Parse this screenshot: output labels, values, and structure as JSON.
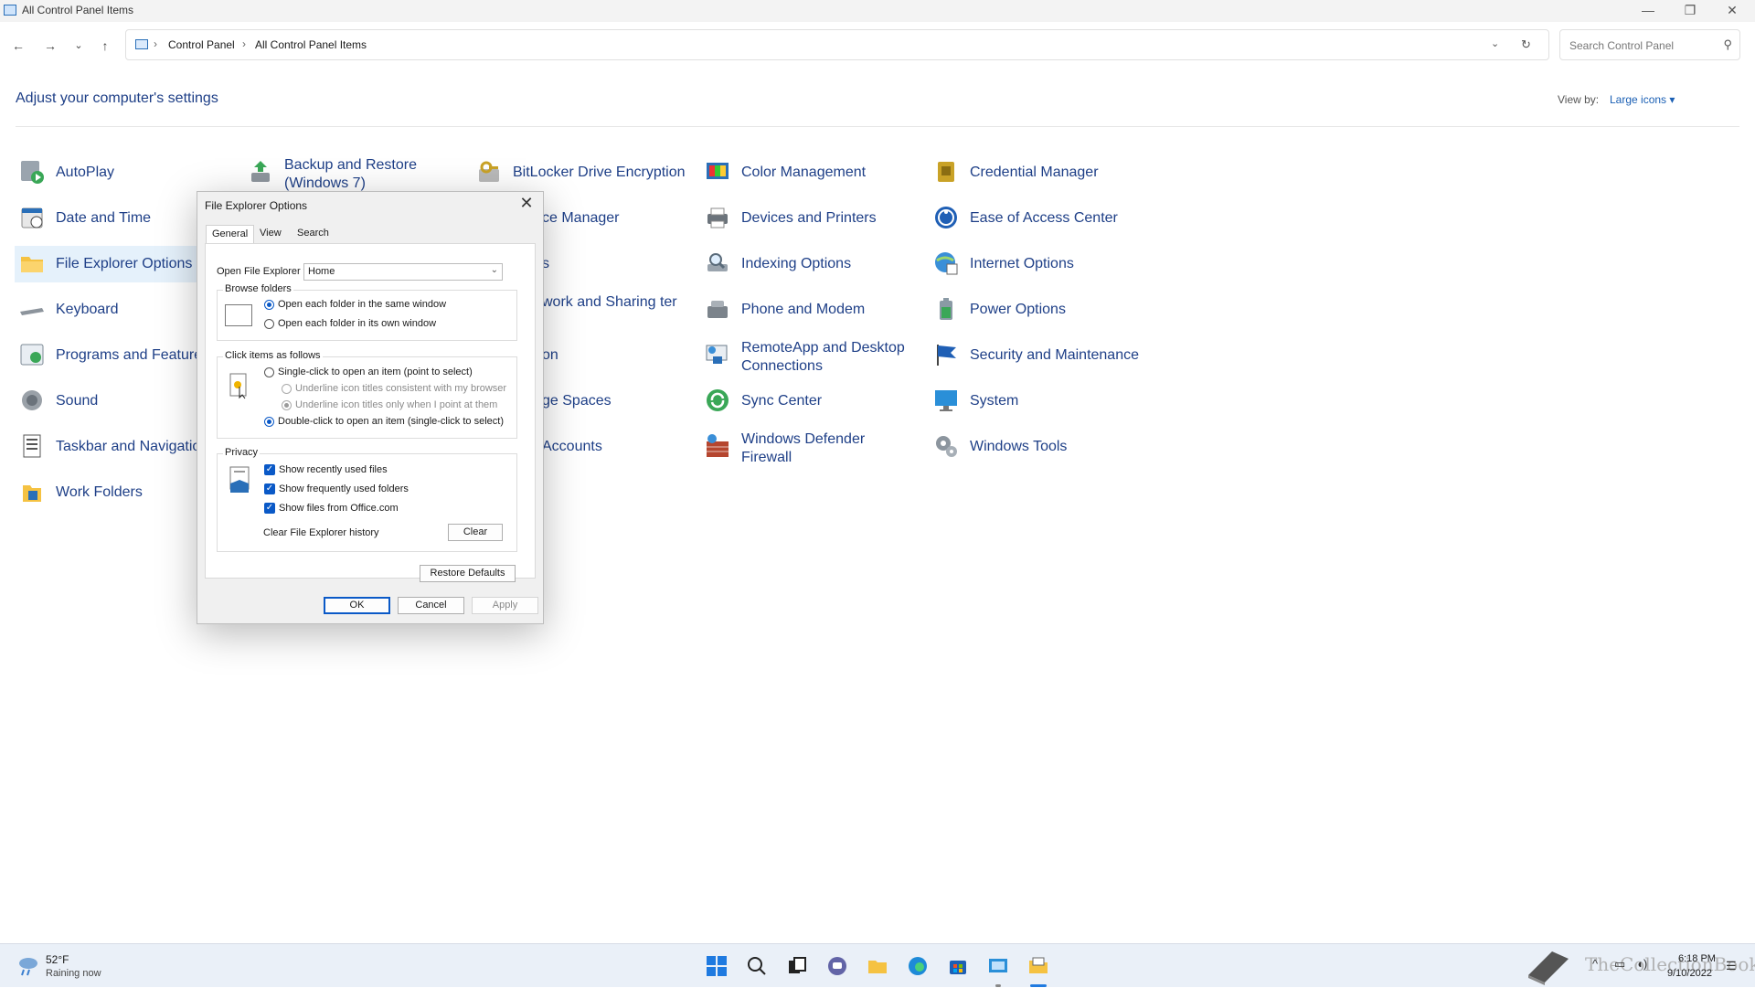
{
  "window": {
    "title": "All Control Panel Items"
  },
  "address": {
    "crumbs": [
      "Control Panel",
      "All Control Panel Items"
    ],
    "separator": "›"
  },
  "search": {
    "placeholder": "Search Control Panel"
  },
  "content": {
    "heading": "Adjust your computer's settings",
    "view_by_label": "View by:",
    "view_by_value": "Large icons ▾"
  },
  "items": [
    {
      "label": "AutoPlay"
    },
    {
      "label": "Backup and Restore (Windows 7)"
    },
    {
      "label": "BitLocker Drive Encryption"
    },
    {
      "label": "Color Management"
    },
    {
      "label": "Credential Manager"
    },
    {
      "label": "Date and Time"
    },
    {
      "label": "ce Manager"
    },
    {
      "label": "Devices and Printers"
    },
    {
      "label": "Ease of Access Center"
    },
    {
      "label": "File Explorer Options"
    },
    {
      "label": "s"
    },
    {
      "label": "Indexing Options"
    },
    {
      "label": "Internet Options"
    },
    {
      "label": "Keyboard"
    },
    {
      "label": "work and Sharing ter"
    },
    {
      "label": "Phone and Modem"
    },
    {
      "label": "Power Options"
    },
    {
      "label": "Programs and Feature"
    },
    {
      "label": "on"
    },
    {
      "label": "RemoteApp and Desktop Connections"
    },
    {
      "label": "Security and Maintenance"
    },
    {
      "label": "Sound"
    },
    {
      "label": "ge Spaces"
    },
    {
      "label": "Sync Center"
    },
    {
      "label": "System"
    },
    {
      "label": "Taskbar and Navigatio"
    },
    {
      "label": "Accounts"
    },
    {
      "label": "Windows Defender Firewall"
    },
    {
      "label": "Windows Tools"
    },
    {
      "label": "Work Folders"
    }
  ],
  "dialog": {
    "title": "File Explorer Options",
    "tabs": [
      "General",
      "View",
      "Search"
    ],
    "open_to_label": "Open File Explorer to:",
    "open_to_value": "Home",
    "browse_title": "Browse folders",
    "browse_opt1": "Open each folder in the same window",
    "browse_opt2": "Open each folder in its own window",
    "click_title": "Click items as follows",
    "click_opt1": "Single-click to open an item (point to select)",
    "click_sub1": "Underline icon titles consistent with my browser",
    "click_sub2": "Underline icon titles only when I point at them",
    "click_opt2": "Double-click to open an item (single-click to select)",
    "privacy_title": "Privacy",
    "privacy_chk1": "Show recently used files",
    "privacy_chk2": "Show frequently used folders",
    "privacy_chk3": "Show files from Office.com",
    "clear_history_label": "Clear File Explorer history",
    "clear_btn": "Clear",
    "restore_btn": "Restore Defaults",
    "ok_btn": "OK",
    "cancel_btn": "Cancel",
    "apply_btn": "Apply"
  },
  "taskbar": {
    "weather_temp": "52°F",
    "weather_desc": "Raining now",
    "time": "6:18 PM",
    "date": "9/10/2022",
    "watermark": "TheCollectionBook"
  }
}
